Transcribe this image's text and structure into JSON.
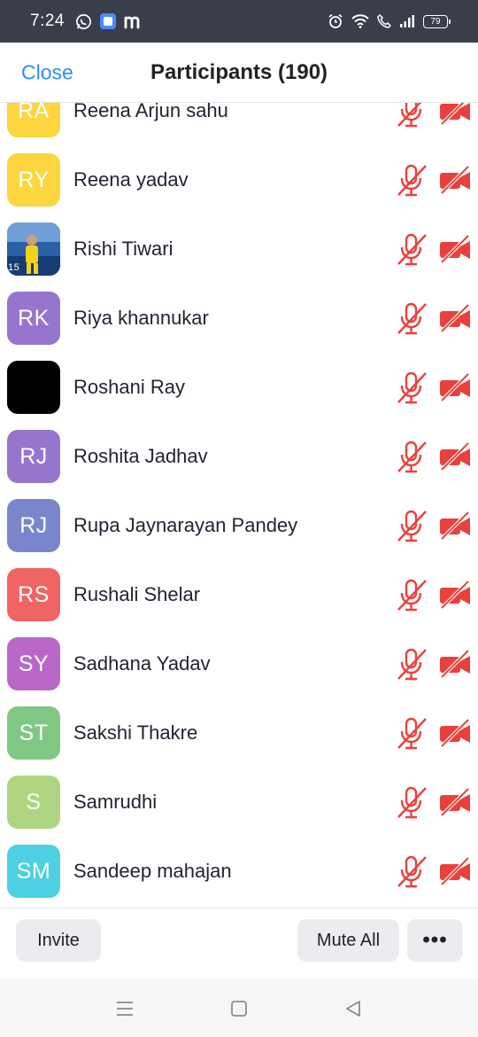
{
  "status_bar": {
    "time": "7:24",
    "left_icons": [
      "whatsapp-icon",
      "app-icon",
      "m-icon"
    ],
    "right_icons": [
      "alarm-icon",
      "wifi-icon",
      "call-icon",
      "signal-icon"
    ],
    "battery": "79"
  },
  "header": {
    "close_label": "Close",
    "title": "Participants (190)",
    "accent_color": "#2d8cff"
  },
  "participants": [
    {
      "initials": "RA",
      "name": "Reena Arjun sahu",
      "color": "#fcd53f"
    },
    {
      "initials": "RY",
      "name": "Reena yadav",
      "color": "#fcd53f"
    },
    {
      "initials": "",
      "name": "Rishi Tiwari",
      "color": "#1e4e8c",
      "photo": true
    },
    {
      "initials": "RK",
      "name": "Riya khannukar",
      "color": "#9575cd"
    },
    {
      "initials": "",
      "name": "Roshani Ray",
      "color": "#000000"
    },
    {
      "initials": "RJ",
      "name": "Roshita Jadhav",
      "color": "#9575cd"
    },
    {
      "initials": "RJ",
      "name": "Rupa Jaynarayan Pandey",
      "color": "#7986cb"
    },
    {
      "initials": "RS",
      "name": "Rushali Shelar",
      "color": "#f06464"
    },
    {
      "initials": "SY",
      "name": "Sadhana Yadav",
      "color": "#ba68c8"
    },
    {
      "initials": "ST",
      "name": "Sakshi Thakre",
      "color": "#81c784"
    },
    {
      "initials": "S",
      "name": "Samrudhi",
      "color": "#aed581"
    },
    {
      "initials": "SM",
      "name": "Sandeep mahajan",
      "color": "#4dd0e1"
    }
  ],
  "status_icon_color": "#e8413c",
  "toolbar": {
    "invite_label": "Invite",
    "mute_all_label": "Mute All",
    "more_label": "•••"
  },
  "navbar": {
    "icons": [
      "menu-icon",
      "home-icon",
      "back-icon"
    ]
  }
}
